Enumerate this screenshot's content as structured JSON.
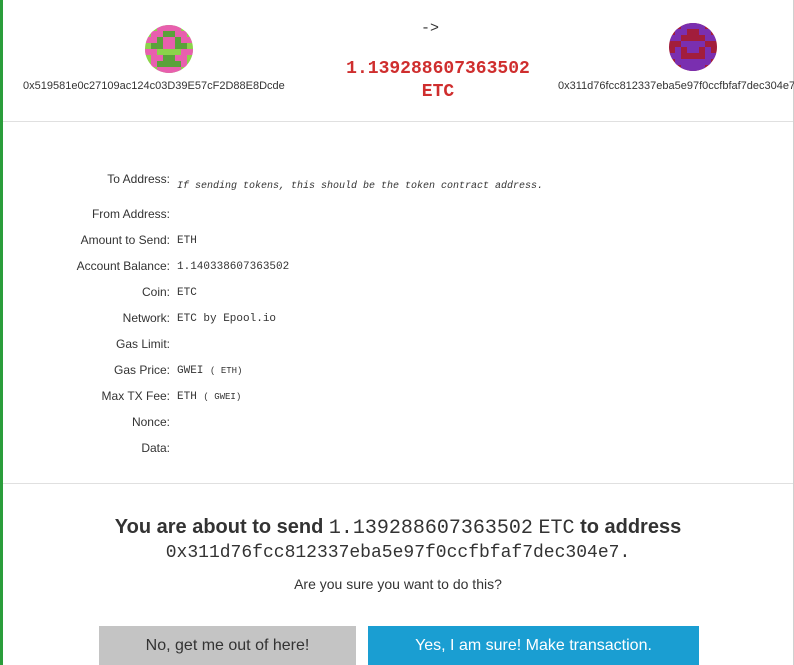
{
  "transfer": {
    "from_address": "0x519581e0c27109ac124c03D39E57cF2D88E8Dcde",
    "to_address": "0x311d76fcc812337eba5e97f0ccfbfaf7dec304e7",
    "arrow": "->",
    "amount": "1.139288607363502",
    "currency": "ETC"
  },
  "details": {
    "to_address_label": "To Address:",
    "to_address_hint": "If sending tokens, this should be the token contract address.",
    "from_address_label": "From Address:",
    "amount_label": "Amount to Send:",
    "amount_value": "ETH",
    "balance_label": "Account Balance:",
    "balance_value": "1.140338607363502",
    "coin_label": "Coin:",
    "coin_value": "ETC",
    "network_label": "Network:",
    "network_value": "ETC by Epool.io",
    "gas_limit_label": "Gas Limit:",
    "gas_price_label": "Gas Price:",
    "gas_price_unit": "GWEI",
    "gas_price_sub": "( ETH)",
    "max_fee_label": "Max TX Fee:",
    "max_fee_unit": "ETH",
    "max_fee_sub": "( GWEI)",
    "nonce_label": "Nonce:",
    "data_label": "Data:"
  },
  "confirm": {
    "prefix": "You are about to send",
    "amount": "1.139288607363502",
    "currency": "ETC",
    "middle": "to address",
    "to_address": "0x311d76fcc812337eba5e97f0ccfbfaf7dec304e7",
    "suffix": ".",
    "question": "Are you sure you want to do this?"
  },
  "buttons": {
    "cancel_label": "No, get me out of here!",
    "confirm_label": "Yes, I am sure! Make transaction."
  },
  "icons": {
    "from_identicon": "identicon-pink-green",
    "to_identicon": "identicon-purple-red"
  },
  "colors": {
    "accent_red": "#cf2e2e",
    "confirm_blue": "#1a9ed2",
    "cancel_gray": "#c4c4c4",
    "left_accent_green": "#2a9d3b"
  }
}
